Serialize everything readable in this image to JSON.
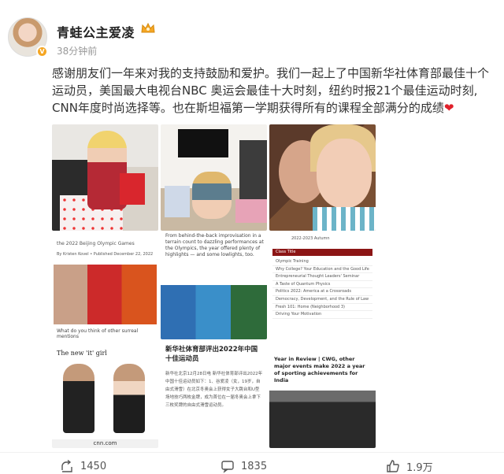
{
  "post": {
    "username": "青蛙公主爱凌",
    "time": "38分钟前",
    "text": "感谢朋友们一年来对我的支持鼓励和爱护。我们一起上了中国新华社体育部最佳十个运动员，美国最大电视台NBC 奥运会最佳十大时刻，纽约时报21个最佳运动时刻, CNN年度时尚选择等。也在斯坦福第一学期获得所有的课程全部满分的成绩",
    "heart": "❤"
  },
  "images": {
    "t4": {
      "line1": "the 2022 Beijing Olympic Games",
      "line2": "By Kristen Kovel • Published December 22, 2022",
      "caption": "What do you think of other surreal mentions"
    },
    "t5": {
      "heading": "From behind-the-back improvisation in a terrain count to dazzling performances at the Olympics, the year offered plenty of highlights — and some lowlights, too."
    },
    "t6": {
      "title": "2022-2023 Autumn",
      "header": "Class Title",
      "classes": [
        "Olympic Training",
        "Why College? Your Education and the Good Life",
        "Entrepreneurial Thought Leaders' Seminar",
        "A Taste of Quantum Physics",
        "Politics 2022: America at a Crossroads",
        "Democracy, Development, and the Rule of Law",
        "Fresh 101: Home (Neighborhood 3)",
        "Driving Your Motivation"
      ]
    },
    "t7": {
      "heading": "The new 'it' girl",
      "url": "cnn.com"
    },
    "t8": {
      "headline": "新华社体育部评出2022年中国十佳运动员",
      "body": "新华社北京12月28日电 新华社体育部评出2022年中国十佳运动员如下：1、谷爱凌（女，19岁，自由式滑雪）在北京冬奥会上获得女子大跳台和U型场地技巧两枚金牌，成为首位在一届冬奥会上拿下三枚奖牌的自由式滑雪运动员。"
    },
    "t9": {
      "headline": "Year in Review | CWG, other major events make 2022 a year of sporting achievements for India"
    }
  },
  "actions": {
    "share_count": "1450",
    "comment_count": "1835",
    "like_count": "1.9万"
  },
  "colors": {
    "accent": "#f5a623",
    "heart": "#e0202a",
    "stanford": "#8c1515"
  },
  "icons": [
    "crown-icon",
    "verified-badge-icon",
    "share-icon",
    "comment-icon",
    "like-icon"
  ]
}
